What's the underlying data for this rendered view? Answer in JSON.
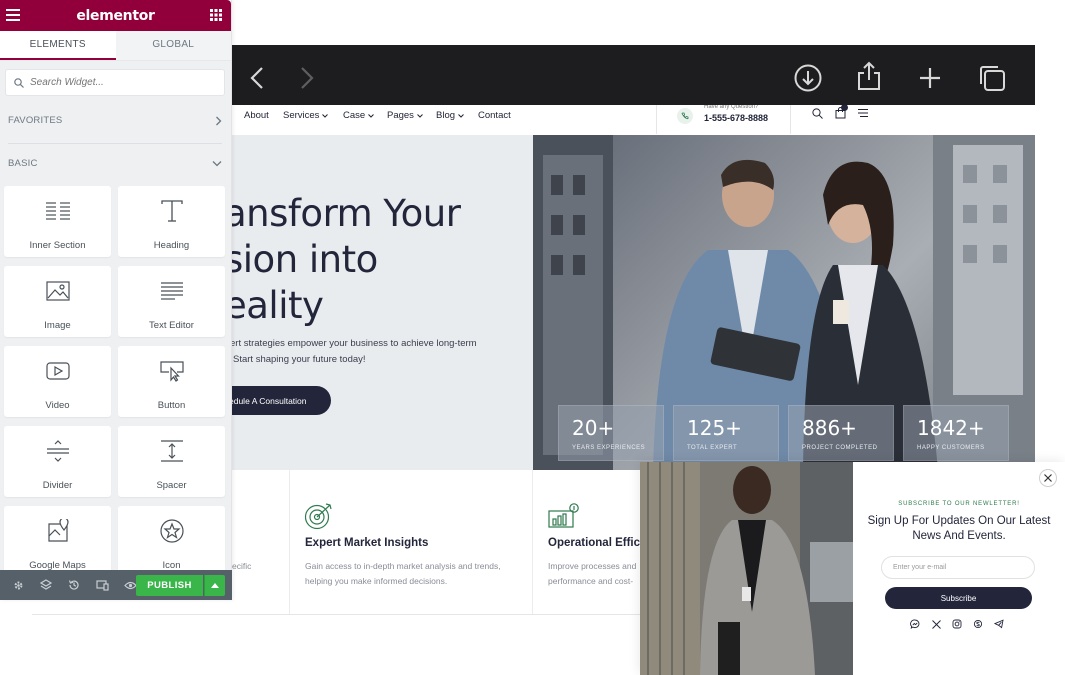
{
  "panel": {
    "brand": "elementor",
    "tabs": [
      {
        "label": "ELEMENTS",
        "active": true
      },
      {
        "label": "GLOBAL",
        "active": false
      }
    ],
    "search_placeholder": "Search Widget...",
    "categories": {
      "favorites": "FAVORITES",
      "basic": "BASIC"
    },
    "widgets": [
      {
        "label": "Inner Section",
        "icon": "inner-section-icon"
      },
      {
        "label": "Heading",
        "icon": "heading-icon"
      },
      {
        "label": "Image",
        "icon": "image-icon"
      },
      {
        "label": "Text Editor",
        "icon": "text-editor-icon"
      },
      {
        "label": "Video",
        "icon": "video-icon"
      },
      {
        "label": "Button",
        "icon": "button-icon"
      },
      {
        "label": "Divider",
        "icon": "divider-icon"
      },
      {
        "label": "Spacer",
        "icon": "spacer-icon"
      },
      {
        "label": "Google Maps",
        "icon": "map-icon"
      },
      {
        "label": "Icon",
        "icon": "star-icon"
      }
    ],
    "footer": {
      "publish_label": "PUBLISH"
    },
    "colors": {
      "brand": "#92003b",
      "publish": "#39b54a",
      "footer": "#556068"
    }
  },
  "browser": {
    "icons": [
      "back-icon",
      "forward-icon",
      "download-icon",
      "share-icon",
      "new-tab-icon",
      "tabs-icon"
    ]
  },
  "site": {
    "nav": [
      {
        "label": "About",
        "dropdown": false
      },
      {
        "label": "Services",
        "dropdown": true
      },
      {
        "label": "Case",
        "dropdown": true
      },
      {
        "label": "Pages",
        "dropdown": true
      },
      {
        "label": "Blog",
        "dropdown": true
      },
      {
        "label": "Contact",
        "dropdown": false
      }
    ],
    "phone_label": "Have any Question?",
    "phone_number": "1-555-678-8888",
    "hero": {
      "title_lines": [
        "ansform Your",
        "sion into",
        "eality"
      ],
      "subtitle_lines": [
        "ert strategies empower your business to achieve long-term",
        "Start shaping your future today!"
      ],
      "cta": "edule A Consultation"
    },
    "stats": [
      {
        "value": "20+",
        "label": "YEARS EXPERIENCES"
      },
      {
        "value": "125+",
        "label": "TOTAL EXPERT"
      },
      {
        "value": "886+",
        "label": "PROJECT COMPLETED"
      },
      {
        "value": "1842+",
        "label": "HAPPY CUSTOMERS"
      }
    ],
    "features": [
      {
        "title": "",
        "lines": [
          "ecific"
        ]
      },
      {
        "title": "Expert Market Insights",
        "lines": [
          "Gain access to in-depth market analysis and trends,",
          "helping you make informed decisions."
        ]
      },
      {
        "title": "Operational Effici",
        "lines": [
          "Improve processes and",
          "performance and cost-"
        ]
      }
    ]
  },
  "popup": {
    "kicker": "SUBSCRIBE TO OUR NEWLETTER!",
    "title": "Sign Up For Updates On Our Latest News And Events.",
    "input_placeholder": "Enter your e-mail",
    "button": "Subscribe",
    "socials": [
      "messenger-icon",
      "x-icon",
      "instagram-icon",
      "skype-icon",
      "telegram-icon"
    ]
  }
}
